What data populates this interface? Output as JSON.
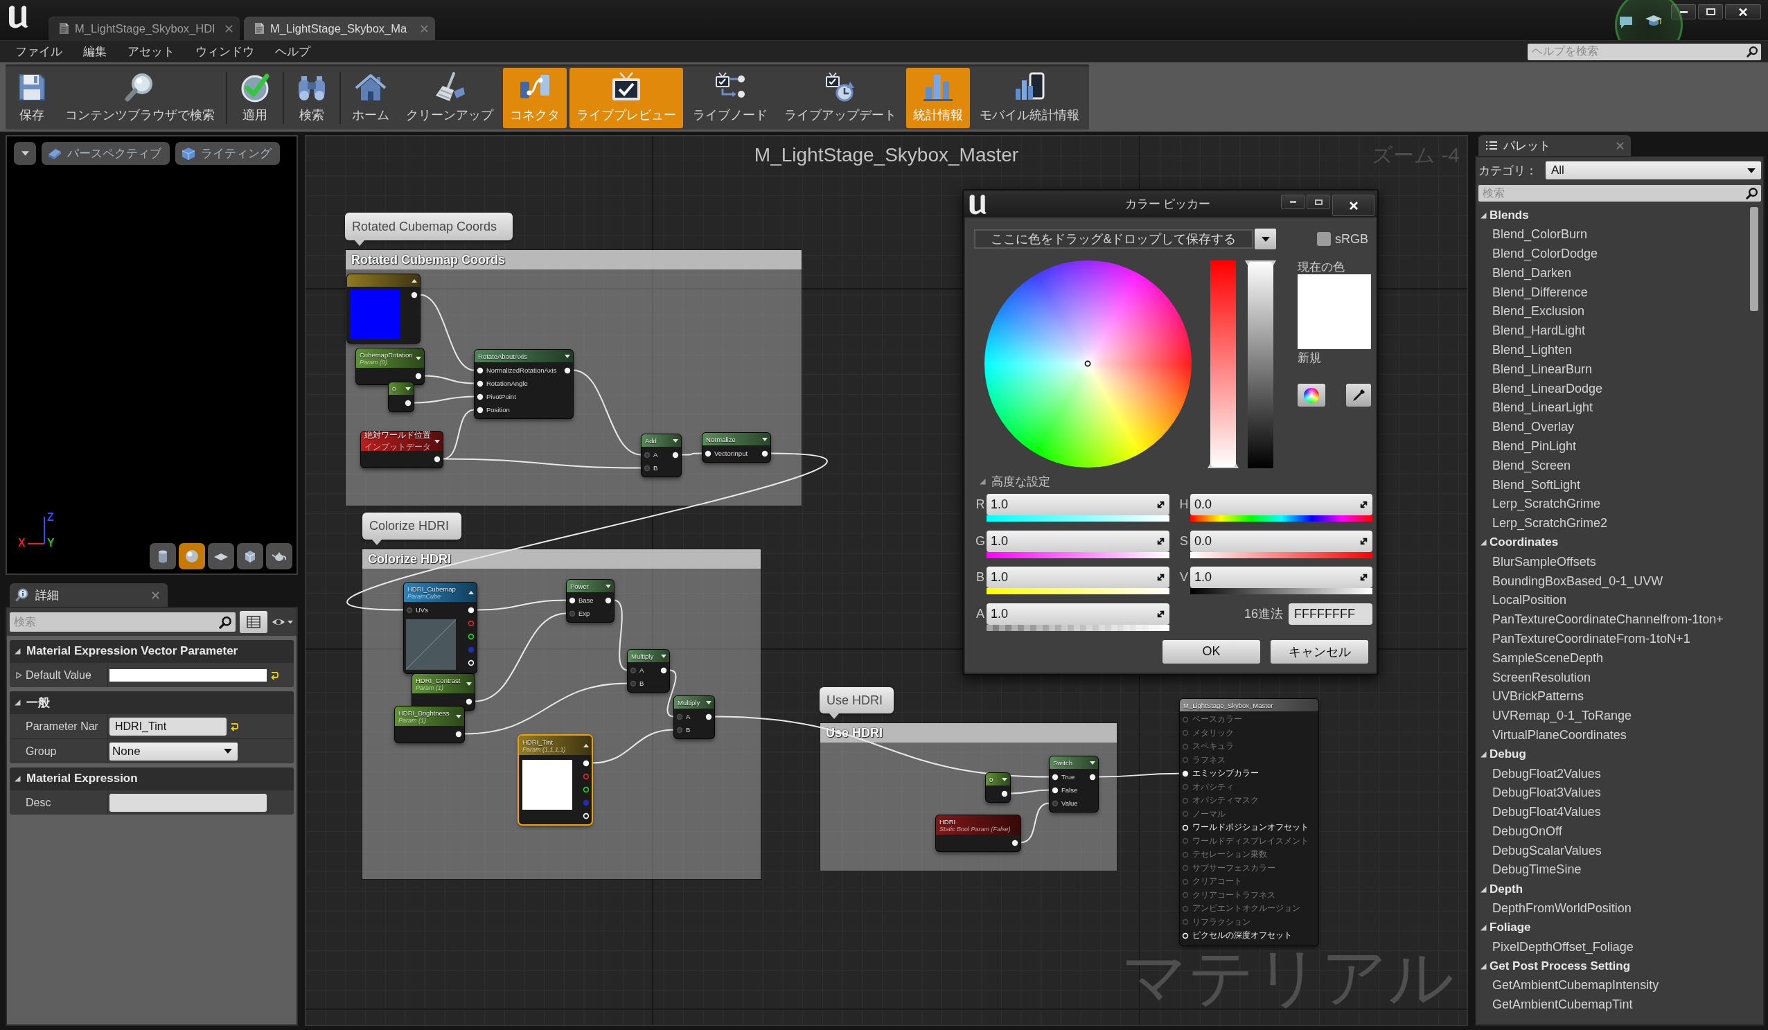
{
  "title_bar": {
    "tabs": [
      {
        "label": "M_LightStage_Skybox_HDI",
        "selected": false
      },
      {
        "label": "M_LightStage_Skybox_Ma",
        "selected": true
      }
    ]
  },
  "menu_bar": {
    "items": [
      "ファイル",
      "編集",
      "アセット",
      "ウィンドウ",
      "ヘルプ"
    ],
    "help_search": {
      "placeholder": "ヘルプを検索"
    }
  },
  "toolbar": [
    {
      "kind": "save",
      "label": "保存",
      "on": false
    },
    {
      "kind": "browse",
      "label": "コンテンツブラウザで検索",
      "on": false
    },
    {
      "kind": "apply",
      "label": "適用",
      "on": false
    },
    {
      "kind": "search",
      "label": "検索",
      "on": false
    },
    {
      "kind": "home",
      "label": "ホーム",
      "on": false
    },
    {
      "kind": "cleanup",
      "label": "クリーンアップ",
      "on": false
    },
    {
      "kind": "connectors",
      "label": "コネクタ",
      "on": true
    },
    {
      "kind": "live_preview",
      "label": "ライブプレビュー",
      "on": true
    },
    {
      "kind": "live_nodes",
      "label": "ライブノード",
      "on": false
    },
    {
      "kind": "live_update",
      "label": "ライブアップデート",
      "on": false
    },
    {
      "kind": "stats",
      "label": "統計情報",
      "on": true
    },
    {
      "kind": "mobile_stats",
      "label": "モバイル統計情報",
      "on": false
    }
  ],
  "viewport": {
    "buttons": [
      {
        "kind": "perspective",
        "label": "パースペクティブ"
      },
      {
        "kind": "lighting",
        "label": "ライティング"
      }
    ],
    "axes": [
      {
        "kind": "z",
        "label": "Z"
      },
      {
        "kind": "x",
        "label": "X"
      },
      {
        "kind": "y",
        "label": "Y"
      }
    ],
    "preview_shapes": [
      {
        "kind": "cylinder",
        "selected": false
      },
      {
        "kind": "sphere",
        "selected": true
      },
      {
        "kind": "plane",
        "selected": false
      },
      {
        "kind": "cube",
        "selected": false
      },
      {
        "kind": "teapot",
        "selected": false
      }
    ]
  },
  "details": {
    "tab": "詳細",
    "search": {
      "placeholder": "検索"
    },
    "sections": [
      {
        "title": "Material Expression Vector Parameter",
        "expanded": true,
        "rows": [
          {
            "kind": "color",
            "label": "Default Value",
            "expanded": false,
            "modified": true
          }
        ]
      },
      {
        "title": "一般",
        "expanded": true,
        "rows": [
          {
            "kind": "text",
            "label": "Parameter Nar",
            "value": "HDRI_Tint",
            "modified": true
          },
          {
            "kind": "dropdown",
            "label": "Group",
            "value": "None",
            "modified": false
          }
        ]
      },
      {
        "title": "Material Expression",
        "expanded": true,
        "rows": [
          {
            "kind": "text",
            "label": "Desc",
            "modified": false
          }
        ]
      }
    ]
  },
  "graph": {
    "title": "M_LightStage_Skybox_Master",
    "zoom": "ズーム -4",
    "type_label": "マテリアル",
    "comments": [
      {
        "bubble": "Rotated Cubemap Coords",
        "title": "Rotated Cubemap Coords"
      },
      {
        "bubble": "Colorize HDRI",
        "title": "Colorize HDRI"
      },
      {
        "bubble": "Use HDRI",
        "title": "Use HDRI"
      }
    ],
    "nodes": [
      {
        "kind": "vector_param",
        "color": "#0000ff",
        "selected": false,
        "outputs": [
          {
            "filled": true
          }
        ]
      },
      {
        "kind": "scalar_param",
        "title": "CubemapRotation",
        "subtitle": "Param (0)",
        "selected": false,
        "outputs": [
          {
            "filled": true
          }
        ]
      },
      {
        "kind": "constant",
        "title": "0",
        "selected": false,
        "outputs": [
          {
            "filled": true
          }
        ]
      },
      {
        "kind": "function",
        "title": "RotateAboutAxis",
        "selected": false,
        "inputs": [
          {
            "label": "NormalizedRotationAxis",
            "filled": true
          },
          {
            "label": "RotationAngle",
            "filled": true
          },
          {
            "label": "PivotPoint",
            "filled": true
          },
          {
            "label": "Position",
            "filled": true
          }
        ],
        "outputs": [
          {
            "filled": true
          }
        ]
      },
      {
        "kind": "input_data",
        "title": "絶対ワールド位置",
        "subtitle": "インプットデータ",
        "selected": false,
        "outputs": [
          {
            "filled": true
          }
        ]
      },
      {
        "kind": "math",
        "title": "Add",
        "selected": false,
        "inputs": [
          {
            "label": "A",
            "filled": false
          },
          {
            "label": "B",
            "filled": false
          }
        ],
        "outputs": [
          {
            "filled": true
          }
        ]
      },
      {
        "kind": "math",
        "title": "Normalize",
        "selected": false,
        "inputs": [
          {
            "label": "VectorInput",
            "filled": true
          }
        ],
        "outputs": [
          {
            "filled": true
          }
        ]
      },
      {
        "kind": "texture_param",
        "title": "HDRI_Cubemap",
        "subtitle": "ParamCube",
        "selected": false,
        "inputs": [
          {
            "label": "UVs",
            "filled": false
          }
        ],
        "outputs": [
          {
            "filled": true,
            "color": "#ffffff"
          },
          {
            "filled": false,
            "color": "#e02a2a"
          },
          {
            "filled": false,
            "color": "#2ad42a"
          },
          {
            "filled": true,
            "color": "#1f2fb0"
          },
          {
            "filled": false,
            "color": "#ffffff"
          }
        ]
      },
      {
        "kind": "math",
        "title": "Power",
        "selected": false,
        "inputs": [
          {
            "label": "Base",
            "filled": true
          },
          {
            "label": "Exp",
            "filled": false
          }
        ],
        "outputs": [
          {
            "filled": true
          }
        ]
      },
      {
        "kind": "scalar_param",
        "title": "HDRI_Contrast",
        "subtitle": "Param (1)",
        "selected": false,
        "outputs": [
          {
            "filled": true
          }
        ]
      },
      {
        "kind": "scalar_param",
        "title": "HDRI_Brightness",
        "subtitle": "Param (1)",
        "selected": false,
        "outputs": [
          {
            "filled": true
          }
        ]
      },
      {
        "kind": "math",
        "title": "Multiply",
        "selected": false,
        "inputs": [
          {
            "label": "A",
            "filled": false
          },
          {
            "label": "B",
            "filled": false
          }
        ],
        "outputs": [
          {
            "filled": true
          }
        ]
      },
      {
        "kind": "math",
        "title": "Multiply",
        "selected": false,
        "inputs": [
          {
            "label": "A",
            "filled": false
          },
          {
            "label": "B",
            "filled": false
          }
        ],
        "outputs": [
          {
            "filled": true
          }
        ]
      },
      {
        "kind": "vector_param",
        "title": "HDRI_Tint",
        "subtitle": "Param (1,1,1,1)",
        "color": "#ffffff",
        "selected": true,
        "outputs": [
          {
            "filled": true,
            "color": "#ffffff"
          },
          {
            "filled": false,
            "color": "#e02a2a"
          },
          {
            "filled": false,
            "color": "#2ad42a"
          },
          {
            "filled": true,
            "color": "#1f2fb0"
          },
          {
            "filled": false,
            "color": "#ffffff"
          }
        ]
      },
      {
        "kind": "constant",
        "title": "0",
        "selected": false,
        "outputs": [
          {
            "filled": true
          }
        ]
      },
      {
        "kind": "math",
        "title": "Switch",
        "selected": false,
        "inputs": [
          {
            "label": "True",
            "filled": true
          },
          {
            "label": "False",
            "filled": true
          },
          {
            "label": "Value",
            "filled": false
          }
        ],
        "outputs": [
          {
            "filled": true
          }
        ]
      },
      {
        "kind": "static_bool",
        "title": "HDRI",
        "subtitle": "Static Bool Param (False)",
        "selected": false,
        "outputs": [
          {
            "filled": true
          }
        ]
      }
    ],
    "result_node": {
      "title": "M_LightStage_Skybox_Master",
      "pins": [
        {
          "label": "ベースカラー",
          "enabled": false,
          "filled": false
        },
        {
          "label": "メタリック",
          "enabled": false,
          "filled": false
        },
        {
          "label": "スペキュラ",
          "enabled": false,
          "filled": false
        },
        {
          "label": "ラフネス",
          "enabled": false,
          "filled": false
        },
        {
          "label": "エミッシブカラー",
          "enabled": true,
          "filled": true
        },
        {
          "label": "オパシティ",
          "enabled": false,
          "filled": false
        },
        {
          "label": "オパシティマスク",
          "enabled": false,
          "filled": false
        },
        {
          "label": "ノーマル",
          "enabled": false,
          "filled": false
        },
        {
          "label": "ワールドポジションオフセット",
          "enabled": true,
          "filled": false
        },
        {
          "label": "ワールドディスプレイスメント",
          "enabled": false,
          "filled": false
        },
        {
          "label": "テセレーション乗数",
          "enabled": false,
          "filled": false
        },
        {
          "label": "サブサーフェスカラー",
          "enabled": false,
          "filled": false
        },
        {
          "label": "クリアコート",
          "enabled": false,
          "filled": false
        },
        {
          "label": "クリアコートラフネス",
          "enabled": false,
          "filled": false
        },
        {
          "label": "アンビエントオクルージョン",
          "enabled": false,
          "filled": false
        },
        {
          "label": "リフラクション",
          "enabled": false,
          "filled": false
        },
        {
          "label": "ピクセルの深度オフセット",
          "enabled": true,
          "filled": false
        }
      ]
    }
  },
  "color_picker": {
    "title": "カラー ピッカー",
    "drop_zone": "ここに色をドラッグ&ドロップして保存する",
    "srgb": {
      "label": "sRGB",
      "checked": false
    },
    "saturation_bar": {
      "level": 0
    },
    "value_bar": {
      "level": 1
    },
    "current_label": "現在の色",
    "new_label": "新規",
    "advanced": {
      "label": "高度な設定",
      "expanded": true
    },
    "rgba": [
      {
        "kind": "red",
        "label": "R",
        "value": "1.0"
      },
      {
        "kind": "green",
        "label": "G",
        "value": "1.0"
      },
      {
        "kind": "blue",
        "label": "B",
        "value": "1.0"
      },
      {
        "kind": "alpha",
        "label": "A",
        "value": "1.0"
      }
    ],
    "hsv": [
      {
        "kind": "hue",
        "label": "H",
        "value": "0.0"
      },
      {
        "kind": "saturation",
        "label": "S",
        "value": "0.0"
      },
      {
        "kind": "value",
        "label": "V",
        "value": "1.0"
      }
    ],
    "hex": {
      "label": "16進法",
      "value": "FFFFFFFF"
    },
    "buttons": [
      "OK",
      "キャンセル"
    ]
  },
  "palette": {
    "tab": "パレット",
    "category": {
      "label": "カテゴリ：",
      "value": "All"
    },
    "search": {
      "placeholder": "検索"
    },
    "groups": [
      {
        "label": "Blends",
        "expanded": true,
        "children": [
          {
            "label": "Blend_ColorBurn"
          },
          {
            "label": "Blend_ColorDodge"
          },
          {
            "label": "Blend_Darken"
          },
          {
            "label": "Blend_Difference"
          },
          {
            "label": "Blend_Exclusion"
          },
          {
            "label": "Blend_HardLight"
          },
          {
            "label": "Blend_Lighten"
          },
          {
            "label": "Blend_LinearBurn"
          },
          {
            "label": "Blend_LinearDodge"
          },
          {
            "label": "Blend_LinearLight"
          },
          {
            "label": "Blend_Overlay"
          },
          {
            "label": "Blend_PinLight"
          },
          {
            "label": "Blend_Screen"
          },
          {
            "label": "Blend_SoftLight"
          },
          {
            "label": "Lerp_ScratchGrime"
          },
          {
            "label": "Lerp_ScratchGrime2"
          }
        ]
      },
      {
        "label": "Coordinates",
        "expanded": true,
        "children": [
          {
            "label": "BlurSampleOffsets"
          },
          {
            "label": "BoundingBoxBased_0-1_UVW"
          },
          {
            "label": "LocalPosition"
          },
          {
            "label": "PanTextureCoordinateChannelfrom-1ton+"
          },
          {
            "label": "PanTextureCoordinateFrom-1toN+1"
          },
          {
            "label": "SampleSceneDepth"
          },
          {
            "label": "ScreenResolution"
          },
          {
            "label": "UVBrickPatterns"
          },
          {
            "label": "UVRemap_0-1_ToRange"
          },
          {
            "label": "VirtualPlaneCoordinates"
          }
        ]
      },
      {
        "label": "Debug",
        "expanded": true,
        "children": [
          {
            "label": "DebugFloat2Values"
          },
          {
            "label": "DebugFloat3Values"
          },
          {
            "label": "DebugFloat4Values"
          },
          {
            "label": "DebugOnOff"
          },
          {
            "label": "DebugScalarValues"
          },
          {
            "label": "DebugTimeSine"
          }
        ]
      },
      {
        "label": "Depth",
        "expanded": true,
        "children": [
          {
            "label": "DepthFromWorldPosition"
          }
        ]
      },
      {
        "label": "Foliage",
        "expanded": true,
        "children": [
          {
            "label": "PixelDepthOffset_Foliage"
          }
        ]
      },
      {
        "label": "Get Post Process Setting",
        "expanded": true,
        "children": [
          {
            "label": "GetAmbientCubemapIntensity"
          },
          {
            "label": "GetAmbientCubemapTint"
          }
        ]
      }
    ]
  }
}
